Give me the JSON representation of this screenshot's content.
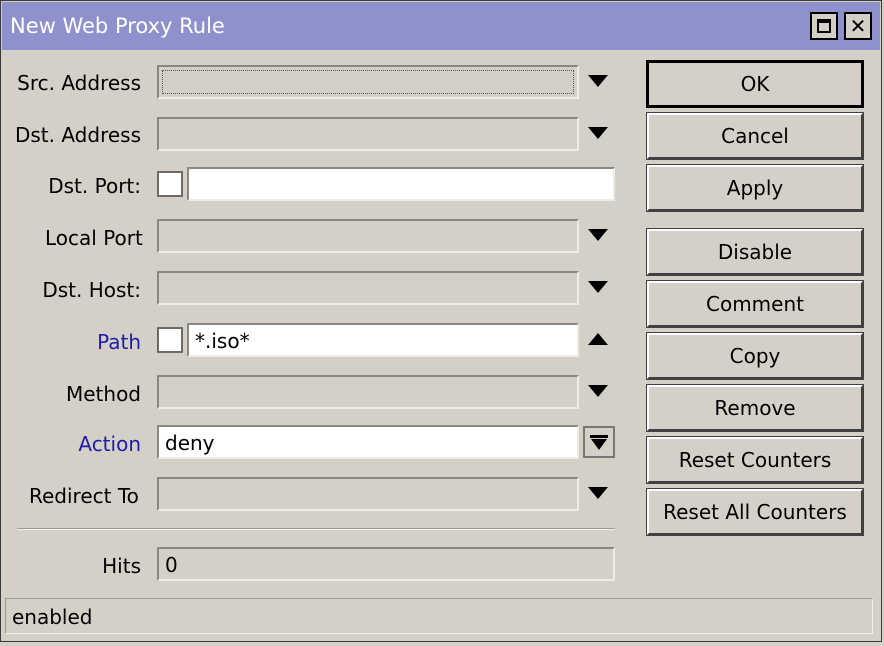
{
  "window": {
    "title": "New Web Proxy Rule"
  },
  "titlebar": {
    "maximize_glyph": "",
    "close_glyph": "✕"
  },
  "form": {
    "src_address": {
      "label": "Src. Address",
      "value": ""
    },
    "dst_address": {
      "label": "Dst. Address",
      "value": ""
    },
    "dst_port": {
      "label": "Dst. Port:",
      "value": ""
    },
    "local_port": {
      "label": "Local Port",
      "value": ""
    },
    "dst_host": {
      "label": "Dst. Host:",
      "value": ""
    },
    "path": {
      "label": "Path",
      "value": "*.iso*"
    },
    "method": {
      "label": "Method",
      "value": ""
    },
    "action": {
      "label": "Action",
      "value": "deny"
    },
    "redirect_to": {
      "label": "Redirect To",
      "value": ""
    },
    "hits": {
      "label": "Hits",
      "value": "0"
    }
  },
  "buttons": {
    "ok": "OK",
    "cancel": "Cancel",
    "apply": "Apply",
    "disable": "Disable",
    "comment": "Comment",
    "copy": "Copy",
    "remove": "Remove",
    "reset_counters": "Reset Counters",
    "reset_all_counters": "Reset All Counters"
  },
  "status": {
    "text": "enabled"
  },
  "colors": {
    "titlebar": "#8f91cc",
    "label_highlight": "#1c1ca8",
    "window_bg": "#d4d0c8"
  },
  "icons": [
    "maximize-icon",
    "close-icon",
    "dropdown-arrow-icon",
    "collapse-arrow-icon",
    "dropdown-select-icon"
  ]
}
